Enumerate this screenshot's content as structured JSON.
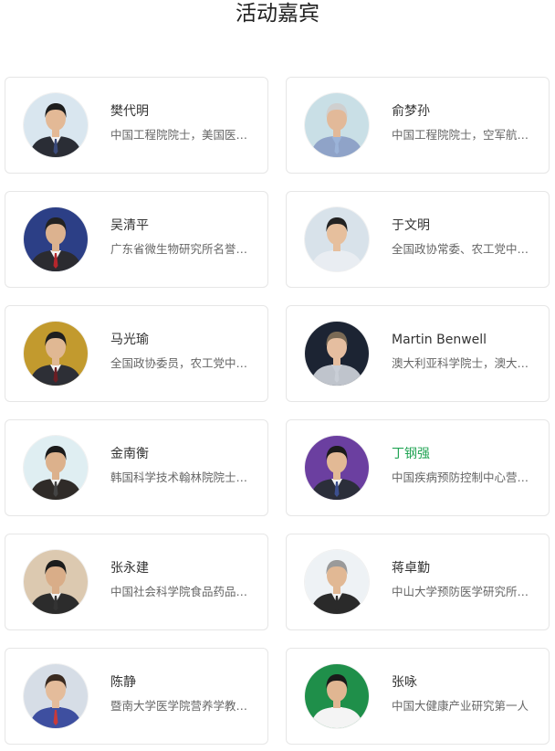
{
  "page": {
    "title": "活动嘉宾"
  },
  "colors": {
    "highlight": "#22a455",
    "card_border": "#e6e6e6"
  },
  "guests": [
    {
      "name": "樊代明",
      "desc": "中国工程院院士，美国医学科学院外籍院士",
      "bg": "#d9e6ef",
      "suit": "#2a2d35",
      "skin": "#e3b996",
      "hair": "#1d1d1d",
      "shirt": "#f2f2f2",
      "tie": "#3a4a7a",
      "highlight": false
    },
    {
      "name": "俞梦孙",
      "desc": "中国工程院院士，空军航空医学研究所研究员",
      "bg": "#c9dfe6",
      "suit": "#8fa3c8",
      "skin": "#e2b999",
      "hair": "#cfcfcf",
      "shirt": "#9bb3d8",
      "tie": "#9bb3d8",
      "highlight": false
    },
    {
      "name": "吴清平",
      "desc": "广东省微生物研究所名誉所长，中国工程院院士",
      "bg": "#2c3f86",
      "suit": "#2b2b30",
      "skin": "#dcb28f",
      "hair": "#222",
      "shirt": "#f2f2f2",
      "tie": "#b5262c",
      "highlight": false
    },
    {
      "name": "于文明",
      "desc": "全国政协常委、农工党中央副主席",
      "bg": "#d8e2ea",
      "suit": "#e9edf2",
      "skin": "#e6bf9d",
      "hair": "#222",
      "shirt": "#e9edf2",
      "tie": "#e9edf2",
      "highlight": false
    },
    {
      "name": "马光瑜",
      "desc": "全国政协委员，农工党中央常委",
      "bg": "#c29a2e",
      "suit": "#2d2f36",
      "skin": "#e0b893",
      "hair": "#1f1f1f",
      "shirt": "#f2f2f2",
      "tie": "#6b1e24",
      "highlight": false
    },
    {
      "name": "Martin Benwell",
      "desc": "澳大利亚科学院士，澳大利亚营养学会主席",
      "bg": "#1c2433",
      "suit": "#bfc4cc",
      "skin": "#e5bea0",
      "hair": "#7a6a55",
      "shirt": "#c9ced6",
      "tie": "#c9ced6",
      "highlight": false
    },
    {
      "name": "金南衡",
      "desc": "韩国科学技术翰林院院士，韩国营养学会会长",
      "bg": "#dfeef2",
      "suit": "#2f2b28",
      "skin": "#dcb18c",
      "hair": "#1a1a1a",
      "shirt": "#f0f0f0",
      "tie": "#444",
      "highlight": false
    },
    {
      "name": "丁钢强",
      "desc": "中国疾病预防控制中心营养与健康所所长",
      "bg": "#6b3fa0",
      "suit": "#2b2e3a",
      "skin": "#e2b995",
      "hair": "#1b1b1b",
      "shirt": "#f3f3f3",
      "tie": "#3c4f8f",
      "highlight": true
    },
    {
      "name": "张永建",
      "desc": "中国社会科学院食品药品产业发展与监管研究中心主任",
      "bg": "#dcc9b0",
      "suit": "#2c2c2c",
      "skin": "#d9ad88",
      "hair": "#1c1c1c",
      "shirt": "#f0f0f0",
      "tie": "#333",
      "highlight": false
    },
    {
      "name": "蒋卓勤",
      "desc": "中山大学预防医学研究所所长",
      "bg": "#eef2f5",
      "suit": "#2a2a2a",
      "skin": "#e1b894",
      "hair": "#9a9a9a",
      "shirt": "#f3f3f3",
      "tie": "#2a2a2a",
      "highlight": false
    },
    {
      "name": "陈静",
      "desc": "暨南大学医学院营养学教研室主任",
      "bg": "#d6dde6",
      "suit": "#3e4fa0",
      "skin": "#e4bc9b",
      "hair": "#3a2a20",
      "shirt": "#3e4fa0",
      "tie": "#c83a3a",
      "highlight": false
    },
    {
      "name": "张咏",
      "desc": "中国大健康产业研究第一人",
      "bg": "#1f8f4a",
      "suit": "#f4f4f4",
      "skin": "#e0b692",
      "hair": "#1a1a1a",
      "shirt": "#f4f4f4",
      "tie": "#f4f4f4",
      "highlight": false
    }
  ]
}
